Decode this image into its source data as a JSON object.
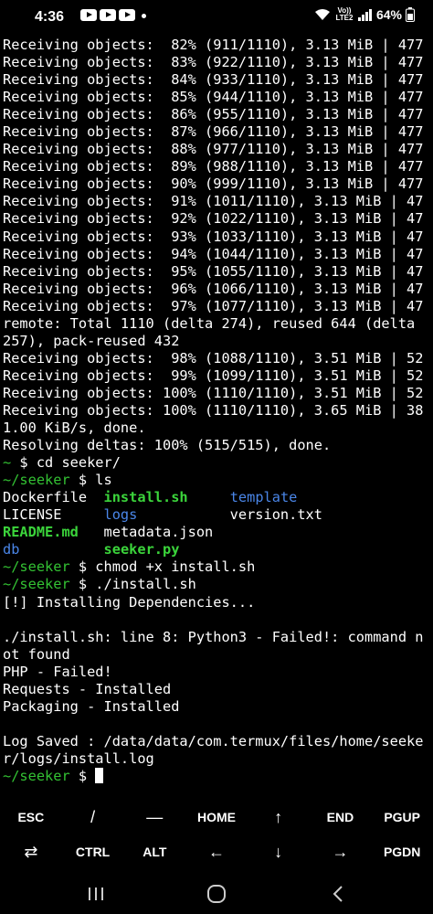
{
  "status_bar": {
    "time": "4:36",
    "battery": "64%",
    "network": "Vo)) LTE2",
    "icons": [
      "youtube-icon",
      "youtube-icon",
      "youtube-icon",
      "notification-dot",
      "wifi-icon",
      "signal-icon",
      "battery-icon"
    ]
  },
  "terminal": {
    "lines": [
      [
        {
          "t": "Receiving objects:  82% (911/1110), 3.13 MiB | 477"
        }
      ],
      [
        {
          "t": "Receiving objects:  83% (922/1110), 3.13 MiB | 477"
        }
      ],
      [
        {
          "t": "Receiving objects:  84% (933/1110), 3.13 MiB | 477"
        }
      ],
      [
        {
          "t": "Receiving objects:  85% (944/1110), 3.13 MiB | 477"
        }
      ],
      [
        {
          "t": "Receiving objects:  86% (955/1110), 3.13 MiB | 477"
        }
      ],
      [
        {
          "t": "Receiving objects:  87% (966/1110), 3.13 MiB | 477"
        }
      ],
      [
        {
          "t": "Receiving objects:  88% (977/1110), 3.13 MiB | 477"
        }
      ],
      [
        {
          "t": "Receiving objects:  89% (988/1110), 3.13 MiB | 477"
        }
      ],
      [
        {
          "t": "Receiving objects:  90% (999/1110), 3.13 MiB | 477"
        }
      ],
      [
        {
          "t": "Receiving objects:  91% (1011/1110), 3.13 MiB | 47"
        }
      ],
      [
        {
          "t": "Receiving objects:  92% (1022/1110), 3.13 MiB | 47"
        }
      ],
      [
        {
          "t": "Receiving objects:  93% (1033/1110), 3.13 MiB | 47"
        }
      ],
      [
        {
          "t": "Receiving objects:  94% (1044/1110), 3.13 MiB | 47"
        }
      ],
      [
        {
          "t": "Receiving objects:  95% (1055/1110), 3.13 MiB | 47"
        }
      ],
      [
        {
          "t": "Receiving objects:  96% (1066/1110), 3.13 MiB | 47"
        }
      ],
      [
        {
          "t": "Receiving objects:  97% (1077/1110), 3.13 MiB | 47"
        }
      ],
      [
        {
          "t": "remote: Total 1110 (delta 274), reused 644 (delta"
        }
      ],
      [
        {
          "t": "257), pack-reused 432"
        }
      ],
      [
        {
          "t": "Receiving objects:  98% (1088/1110), 3.51 MiB | 52"
        }
      ],
      [
        {
          "t": "Receiving objects:  99% (1099/1110), 3.51 MiB | 52"
        }
      ],
      [
        {
          "t": "Receiving objects: 100% (1110/1110), 3.51 MiB | 52"
        }
      ],
      [
        {
          "t": "Receiving objects: 100% (1110/1110), 3.65 MiB | 38"
        }
      ],
      [
        {
          "t": "1.00 KiB/s, done."
        }
      ],
      [
        {
          "t": "Resolving deltas: 100% (515/515), done."
        }
      ],
      [
        {
          "t": "~ ",
          "c": "pr"
        },
        {
          "t": "$ cd seeker/"
        }
      ],
      [
        {
          "t": "~/seeker ",
          "c": "pr"
        },
        {
          "t": "$ ls"
        }
      ],
      [
        {
          "t": "Dockerfile  "
        },
        {
          "t": "install.sh",
          "c": "gb"
        },
        {
          "t": "     "
        },
        {
          "t": "template",
          "c": "bl"
        }
      ],
      [
        {
          "t": "LICENSE     "
        },
        {
          "t": "logs",
          "c": "bl"
        },
        {
          "t": "           version.txt"
        }
      ],
      [
        {
          "t": "README.md",
          "c": "gb"
        },
        {
          "t": "   metadata.json"
        }
      ],
      [
        {
          "t": "db",
          "c": "bl"
        },
        {
          "t": "          "
        },
        {
          "t": "seeker.py",
          "c": "gb"
        }
      ],
      [
        {
          "t": "~/seeker ",
          "c": "pr"
        },
        {
          "t": "$ chmod +x install.sh"
        }
      ],
      [
        {
          "t": "~/seeker ",
          "c": "pr"
        },
        {
          "t": "$ ./install.sh"
        }
      ],
      [
        {
          "t": "[!] Installing Dependencies..."
        }
      ],
      [
        {
          "t": ""
        }
      ],
      [
        {
          "t": "./install.sh: line 8: Python3 - Failed!: command n"
        }
      ],
      [
        {
          "t": "ot found"
        }
      ],
      [
        {
          "t": "PHP - Failed!"
        }
      ],
      [
        {
          "t": "Requests - Installed"
        }
      ],
      [
        {
          "t": "Packaging - Installed"
        }
      ],
      [
        {
          "t": ""
        }
      ],
      [
        {
          "t": "Log Saved : /data/data/com.termux/files/home/seeke"
        }
      ],
      [
        {
          "t": "r/logs/install.log"
        }
      ],
      [
        {
          "t": "~/seeker ",
          "c": "pr"
        },
        {
          "t": "$ "
        },
        {
          "cursor": true
        }
      ]
    ]
  },
  "extra_keys": {
    "row1": [
      {
        "label": "ESC",
        "name": "key-esc"
      },
      {
        "label": "/",
        "name": "key-slash"
      },
      {
        "label": "—",
        "name": "key-dash"
      },
      {
        "label": "HOME",
        "name": "key-home"
      },
      {
        "label": "↑",
        "name": "key-up-arrow"
      },
      {
        "label": "END",
        "name": "key-end"
      },
      {
        "label": "PGUP",
        "name": "key-pgup"
      }
    ],
    "row2": [
      {
        "label": "⇄",
        "name": "key-tab"
      },
      {
        "label": "CTRL",
        "name": "key-ctrl"
      },
      {
        "label": "ALT",
        "name": "key-alt"
      },
      {
        "label": "←",
        "name": "key-left-arrow"
      },
      {
        "label": "↓",
        "name": "key-down-arrow"
      },
      {
        "label": "→",
        "name": "key-right-arrow"
      },
      {
        "label": "PGDN",
        "name": "key-pgdn"
      }
    ]
  },
  "nav_bar": {
    "buttons": [
      "recents-icon",
      "home-icon",
      "back-icon"
    ]
  },
  "colors": {
    "background": "#000000",
    "text": "#ffffff",
    "prompt": "#33c233",
    "executable": "#3bd43b",
    "directory": "#4a86e8"
  }
}
